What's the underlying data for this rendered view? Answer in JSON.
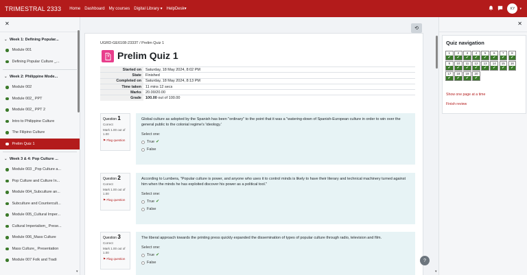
{
  "navbar": {
    "brand": "TRIMESTRAL 2333",
    "links": [
      "Home",
      "Dashboard",
      "My courses",
      "Digital Library ▾",
      "HelpDesk▾"
    ],
    "avatar_initials": "KY"
  },
  "course_index": {
    "sections": [
      {
        "title": "Week 1: Defining Popular...",
        "items": [
          "Module 001",
          "Defining Popular Culture _..."
        ]
      },
      {
        "title": "Week 2: Philippine Mode...",
        "items": [
          "Module 002",
          "Module 002_ PPT",
          "Module 002_ PPT 2",
          "Intro to Philippine Culture",
          "The Filipino Culture",
          "Prelim Quiz 1"
        ]
      },
      {
        "title": "Week 3 & 4: Pop Culture ...",
        "items": [
          "Module 003 _Pop Culture a...",
          "Pop Culture and Culture In...",
          "Module 004_Subculture an...",
          "Subculture and Countercult...",
          "Module 005_Cultural Imper...",
          "Cultural Imperialism_ Prese...",
          "Module 006_Mass Culture",
          "Mass Culture_ Presentation",
          "Module 007  Folk and Tradi"
        ]
      }
    ],
    "active_item": "Prelim Quiz 1"
  },
  "breadcrumb": [
    "UGRD-GE6108-2333T",
    "Prelim Quiz 1"
  ],
  "breadcrumb_sep": "/",
  "page_title": "Prelim Quiz 1",
  "summary": [
    {
      "label": "Started on",
      "value": "Saturday, 18 May 2024, 8:02 PM"
    },
    {
      "label": "State",
      "value": "Finished"
    },
    {
      "label": "Completed on",
      "value": "Saturday, 18 May 2024, 8:13 PM"
    },
    {
      "label": "Time taken",
      "value": "11 mins 12 secs"
    },
    {
      "label": "Marks",
      "value": "20.00/20.00"
    },
    {
      "label": "Grade",
      "value_bold": "100.00",
      "value": " out of 100.00"
    }
  ],
  "questions": [
    {
      "word": "Question",
      "number": "1",
      "status": "Correct",
      "mark": "Mark 1.00 out of 1.00",
      "flag": "Flag question",
      "text": "Global culture as adopted by the Spanish has been \"ordinary\" to the point that it was a \"watering-down of Spanish-European culture in order to win over the general public to the colonial regime's 'ideology.'",
      "prompt": "Select one:",
      "options": [
        "True",
        "False"
      ],
      "correct": "True"
    },
    {
      "word": "Question",
      "number": "2",
      "status": "Correct",
      "mark": "Mark 1.00 out of 1.00",
      "flag": "Flag question",
      "text": "According to Lumbera, \"Popular culture is power, and anyone who uses it to control minds is likely to have their literary and technical machinery turned against him when the minds he has exploited discover his power as a political tool.\"",
      "prompt": "Select one:",
      "options": [
        "True",
        "False"
      ],
      "correct": "True"
    },
    {
      "word": "Question",
      "number": "3",
      "status": "Correct",
      "mark": "Mark 1.00 out of 1.00",
      "flag": "Flag question",
      "text": "The liberal approach towards the printing press quickly expanded the dissemination of types of popular culture through radio, television and film.",
      "prompt": "Select one:",
      "options": [
        "True",
        "False"
      ],
      "correct": "True"
    }
  ],
  "quiz_navigation": {
    "title": "Quiz navigation",
    "buttons": [
      "1",
      "2",
      "3",
      "4",
      "5",
      "6",
      "7",
      "8",
      "9",
      "10",
      "11",
      "12",
      "13",
      "14",
      "15",
      "16",
      "17",
      "18",
      "19",
      "20"
    ],
    "check_glyph": "✔",
    "show_one_page": "Show one page at a time",
    "finish_review": "Finish review"
  },
  "icons": {
    "close": "✕",
    "blocks": "⟲",
    "help": "?",
    "bell": "🔔",
    "chat": "💬",
    "quiz": "📄",
    "flag": "⚑",
    "tick": "✔",
    "chevron": "⌄"
  },
  "colors": {
    "brand": "#b31b1b",
    "correct": "#3b7a2a",
    "quiz_icon": "#e83e8c"
  }
}
